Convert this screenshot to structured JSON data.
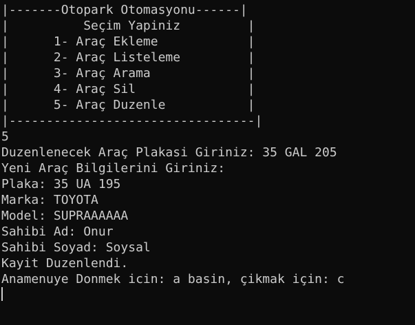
{
  "terminal": {
    "menu": [
      "|-------Otopark Otomasyonu------|",
      "|          Seçim Yapiniz         |",
      "|      1- Araç Ekleme            |",
      "|      2- Araç Listeleme         |",
      "|      3- Araç Arama             |",
      "|      4- Araç Sil               |",
      "|      5- Araç Duzenle           |",
      "|---------------------------------|"
    ],
    "output": [
      "5",
      "Duzenlenecek Araç Plakasi Giriniz: 35 GAL 205",
      "Yeni Araç Bilgilerini Giriniz:",
      "Plaka: 35 UA 195",
      "Marka: TOYOTA",
      "Model: SUPRAAAAAA",
      "Sahibi Ad: Onur",
      "Sahibi Soyad: Soysal",
      "Kayit Duzenlendi.",
      "Anamenuye Donmek icin: a basin, çikmak için: c"
    ],
    "background": "#0c0c0c",
    "foreground": "#cccccc"
  }
}
